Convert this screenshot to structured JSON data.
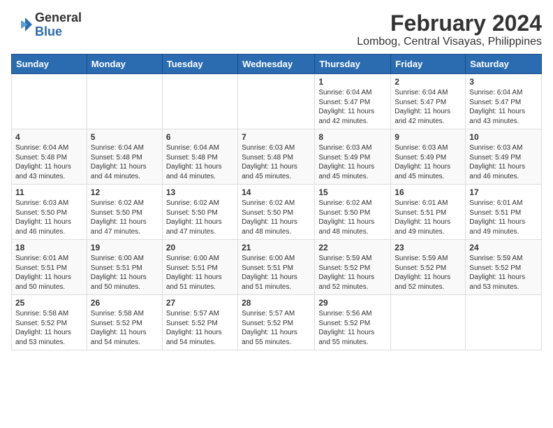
{
  "logo": {
    "general": "General",
    "blue": "Blue"
  },
  "title": "February 2024",
  "location": "Lombog, Central Visayas, Philippines",
  "days_of_week": [
    "Sunday",
    "Monday",
    "Tuesday",
    "Wednesday",
    "Thursday",
    "Friday",
    "Saturday"
  ],
  "weeks": [
    [
      {
        "day": "",
        "info": ""
      },
      {
        "day": "",
        "info": ""
      },
      {
        "day": "",
        "info": ""
      },
      {
        "day": "",
        "info": ""
      },
      {
        "day": "1",
        "info": "Sunrise: 6:04 AM\nSunset: 5:47 PM\nDaylight: 11 hours\nand 42 minutes."
      },
      {
        "day": "2",
        "info": "Sunrise: 6:04 AM\nSunset: 5:47 PM\nDaylight: 11 hours\nand 42 minutes."
      },
      {
        "day": "3",
        "info": "Sunrise: 6:04 AM\nSunset: 5:47 PM\nDaylight: 11 hours\nand 43 minutes."
      }
    ],
    [
      {
        "day": "4",
        "info": "Sunrise: 6:04 AM\nSunset: 5:48 PM\nDaylight: 11 hours\nand 43 minutes."
      },
      {
        "day": "5",
        "info": "Sunrise: 6:04 AM\nSunset: 5:48 PM\nDaylight: 11 hours\nand 44 minutes."
      },
      {
        "day": "6",
        "info": "Sunrise: 6:04 AM\nSunset: 5:48 PM\nDaylight: 11 hours\nand 44 minutes."
      },
      {
        "day": "7",
        "info": "Sunrise: 6:03 AM\nSunset: 5:48 PM\nDaylight: 11 hours\nand 45 minutes."
      },
      {
        "day": "8",
        "info": "Sunrise: 6:03 AM\nSunset: 5:49 PM\nDaylight: 11 hours\nand 45 minutes."
      },
      {
        "day": "9",
        "info": "Sunrise: 6:03 AM\nSunset: 5:49 PM\nDaylight: 11 hours\nand 45 minutes."
      },
      {
        "day": "10",
        "info": "Sunrise: 6:03 AM\nSunset: 5:49 PM\nDaylight: 11 hours\nand 46 minutes."
      }
    ],
    [
      {
        "day": "11",
        "info": "Sunrise: 6:03 AM\nSunset: 5:50 PM\nDaylight: 11 hours\nand 46 minutes."
      },
      {
        "day": "12",
        "info": "Sunrise: 6:02 AM\nSunset: 5:50 PM\nDaylight: 11 hours\nand 47 minutes."
      },
      {
        "day": "13",
        "info": "Sunrise: 6:02 AM\nSunset: 5:50 PM\nDaylight: 11 hours\nand 47 minutes."
      },
      {
        "day": "14",
        "info": "Sunrise: 6:02 AM\nSunset: 5:50 PM\nDaylight: 11 hours\nand 48 minutes."
      },
      {
        "day": "15",
        "info": "Sunrise: 6:02 AM\nSunset: 5:50 PM\nDaylight: 11 hours\nand 48 minutes."
      },
      {
        "day": "16",
        "info": "Sunrise: 6:01 AM\nSunset: 5:51 PM\nDaylight: 11 hours\nand 49 minutes."
      },
      {
        "day": "17",
        "info": "Sunrise: 6:01 AM\nSunset: 5:51 PM\nDaylight: 11 hours\nand 49 minutes."
      }
    ],
    [
      {
        "day": "18",
        "info": "Sunrise: 6:01 AM\nSunset: 5:51 PM\nDaylight: 11 hours\nand 50 minutes."
      },
      {
        "day": "19",
        "info": "Sunrise: 6:00 AM\nSunset: 5:51 PM\nDaylight: 11 hours\nand 50 minutes."
      },
      {
        "day": "20",
        "info": "Sunrise: 6:00 AM\nSunset: 5:51 PM\nDaylight: 11 hours\nand 51 minutes."
      },
      {
        "day": "21",
        "info": "Sunrise: 6:00 AM\nSunset: 5:51 PM\nDaylight: 11 hours\nand 51 minutes."
      },
      {
        "day": "22",
        "info": "Sunrise: 5:59 AM\nSunset: 5:52 PM\nDaylight: 11 hours\nand 52 minutes."
      },
      {
        "day": "23",
        "info": "Sunrise: 5:59 AM\nSunset: 5:52 PM\nDaylight: 11 hours\nand 52 minutes."
      },
      {
        "day": "24",
        "info": "Sunrise: 5:59 AM\nSunset: 5:52 PM\nDaylight: 11 hours\nand 53 minutes."
      }
    ],
    [
      {
        "day": "25",
        "info": "Sunrise: 5:58 AM\nSunset: 5:52 PM\nDaylight: 11 hours\nand 53 minutes."
      },
      {
        "day": "26",
        "info": "Sunrise: 5:58 AM\nSunset: 5:52 PM\nDaylight: 11 hours\nand 54 minutes."
      },
      {
        "day": "27",
        "info": "Sunrise: 5:57 AM\nSunset: 5:52 PM\nDaylight: 11 hours\nand 54 minutes."
      },
      {
        "day": "28",
        "info": "Sunrise: 5:57 AM\nSunset: 5:52 PM\nDaylight: 11 hours\nand 55 minutes."
      },
      {
        "day": "29",
        "info": "Sunrise: 5:56 AM\nSunset: 5:52 PM\nDaylight: 11 hours\nand 55 minutes."
      },
      {
        "day": "",
        "info": ""
      },
      {
        "day": "",
        "info": ""
      }
    ]
  ]
}
